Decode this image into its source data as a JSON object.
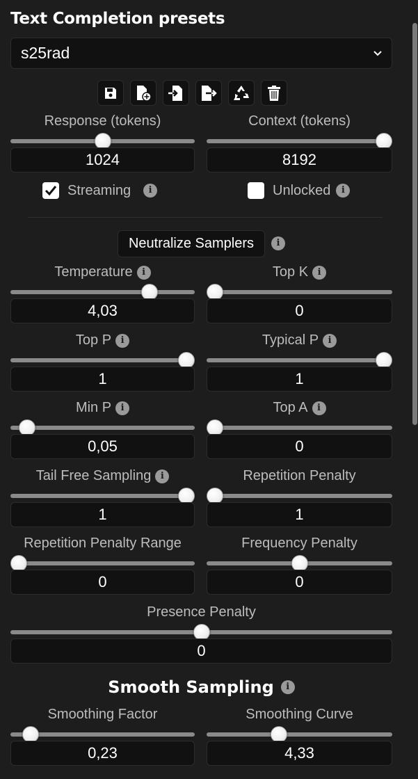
{
  "panel": {
    "title": "Text Completion presets",
    "preset": "s25rad"
  },
  "toolbar": {
    "buttons": [
      "save-icon",
      "new-file-icon",
      "import-icon",
      "export-icon",
      "recycle-icon",
      "trash-icon"
    ]
  },
  "response": {
    "label": "Response (tokens)",
    "value": "1024",
    "fraction": 0.5
  },
  "context": {
    "label": "Context (tokens)",
    "value": "8192",
    "fraction": 1.0
  },
  "streaming": {
    "label": "Streaming",
    "checked": true
  },
  "unlocked": {
    "label": "Unlocked",
    "checked": false
  },
  "neutralize": {
    "label": "Neutralize Samplers"
  },
  "sliders": [
    {
      "id": "temperature",
      "label": "Temperature",
      "info": true,
      "value": "4,03",
      "fraction": 0.78
    },
    {
      "id": "top-k",
      "label": "Top K",
      "info": true,
      "value": "0",
      "fraction": 0.0
    },
    {
      "id": "top-p",
      "label": "Top P",
      "info": true,
      "value": "1",
      "fraction": 1.0
    },
    {
      "id": "typical-p",
      "label": "Typical P",
      "info": true,
      "value": "1",
      "fraction": 1.0
    },
    {
      "id": "min-p",
      "label": "Min P",
      "info": true,
      "value": "0,05",
      "fraction": 0.05
    },
    {
      "id": "top-a",
      "label": "Top A",
      "info": true,
      "value": "0",
      "fraction": 0.0
    },
    {
      "id": "tail-free-sampling",
      "label": "Tail Free Sampling",
      "info": true,
      "value": "1",
      "fraction": 1.0
    },
    {
      "id": "repetition-penalty",
      "label": "Repetition Penalty",
      "info": false,
      "value": "1",
      "fraction": 0.0
    },
    {
      "id": "repetition-penalty-range",
      "label": "Repetition Penalty Range",
      "info": false,
      "value": "0",
      "fraction": 0.0
    },
    {
      "id": "frequency-penalty",
      "label": "Frequency Penalty",
      "info": false,
      "value": "0",
      "fraction": 0.5
    }
  ],
  "presence": {
    "label": "Presence Penalty",
    "value": "0",
    "fraction": 0.5
  },
  "smooth": {
    "title": "Smooth Sampling",
    "factor": {
      "label": "Smoothing Factor",
      "value": "0,23",
      "fraction": 0.07
    },
    "curve": {
      "label": "Smoothing Curve",
      "value": "4,33",
      "fraction": 0.38
    }
  }
}
